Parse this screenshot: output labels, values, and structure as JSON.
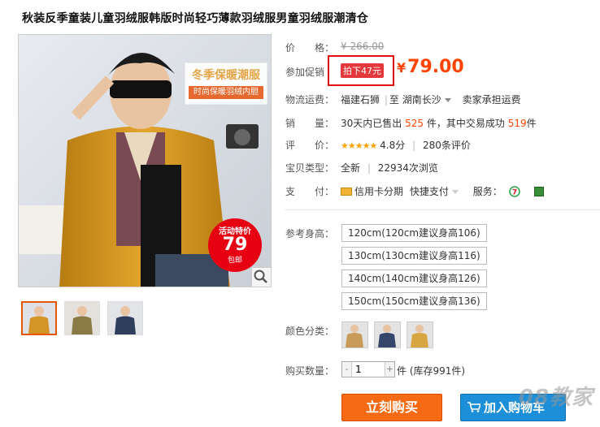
{
  "product": {
    "title": "秋装反季童装儿童羽绒服韩版时尚轻巧薄款羽绒服男童羽绒服潮清仓"
  },
  "gallery": {
    "main_banner": "冬季保暖潮服",
    "main_subbanner": "时尚保暖羽绒内胆",
    "sale_badge_top": "活动特价",
    "sale_badge_price": "79",
    "sale_badge_bottom": "包邮"
  },
  "price": {
    "label": "价　　格：",
    "original": "¥ 266.00",
    "promo_label": "参加促销",
    "promo_tag": "拍下47元",
    "currency": "¥",
    "promo_price": "79.00"
  },
  "shipping": {
    "label": "物流运费：",
    "from": "福建石狮",
    "sep": "|",
    "to_prefix": "至",
    "to": "湖南长沙",
    "fee": "卖家承担运费"
  },
  "sales": {
    "label": "销　　量：",
    "prefix": "30天内已售出",
    "count": "525",
    "mid": "件，其中交易成功",
    "success": "519",
    "suffix": "件"
  },
  "rating": {
    "label": "评　　价：",
    "stars": "★★★★★",
    "score": "4.8分",
    "sep": "|",
    "reviews": "280条评价"
  },
  "item_type": {
    "label": "宝贝类型：",
    "value": "全新",
    "sep": "|",
    "views": "22934次浏览"
  },
  "payment": {
    "label": "支　　付：",
    "credit": "信用卡分期",
    "fast": "快捷支付",
    "service_label": "服务："
  },
  "sizes": {
    "label": "参考身高：",
    "options": [
      "120cm(120cm建议身高106)",
      "130cm(130cm建议身高116)",
      "140cm(140cm建议身高126)",
      "150cm(150cm建议身高136)"
    ]
  },
  "colors": {
    "label": "颜色分类：",
    "swatch_icons": [
      "tan-jacket-icon",
      "navy-jacket-icon",
      "khaki-jacket-icon"
    ]
  },
  "quantity": {
    "label": "购买数量：",
    "minus": "-",
    "value": "1",
    "plus": "+",
    "unit": "件",
    "stock": "(库存991件)"
  },
  "actions": {
    "buy": "立刻购买",
    "cart": "加入购物车"
  },
  "watermark": "08教家",
  "colors_theme": {
    "accent": "#ff4400",
    "buy": "#f56a12",
    "cart": "#1d8fd8",
    "highlight_box": "#e01010"
  }
}
